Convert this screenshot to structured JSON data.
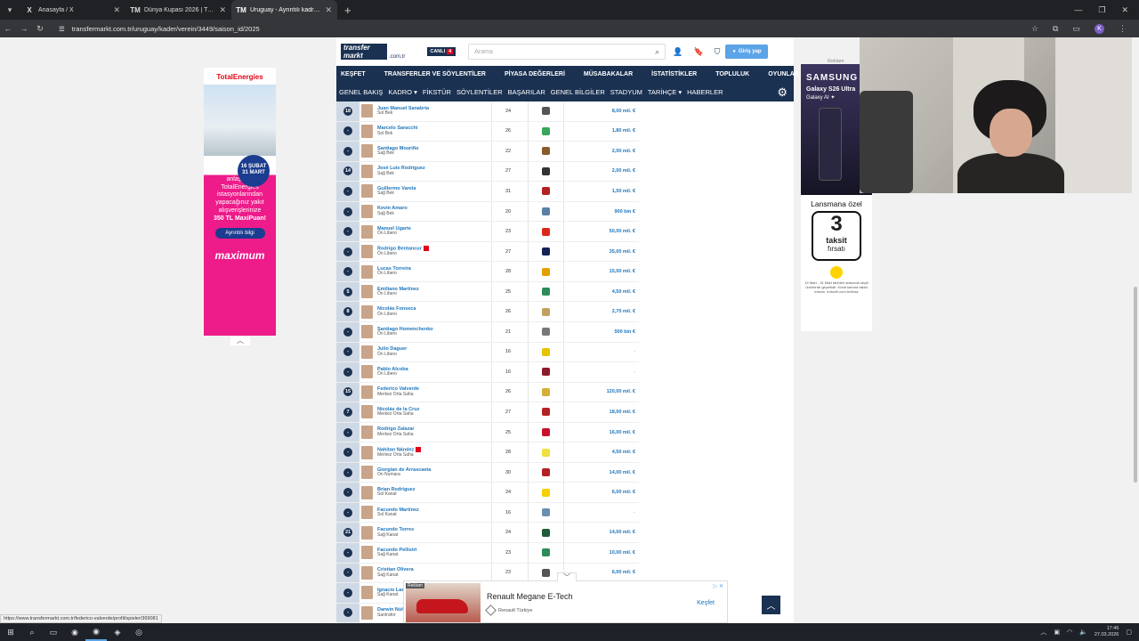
{
  "browser": {
    "tabs": [
      {
        "icon": "X",
        "title": "Anasayfa / X",
        "active": false
      },
      {
        "icon": "TM",
        "title": "Dünya Kupası 2026 | Transferm",
        "active": false
      },
      {
        "icon": "TM",
        "title": "Uruguay - Ayrıntılı kadro 2025",
        "active": true
      }
    ],
    "url": "transfermarkt.com.tr/uruguay/kader/verein/3449/saison_id/2025",
    "profile_letter": "K"
  },
  "site": {
    "logo_line1": "transfer",
    "logo_line2": "markt",
    "domain": ".com.tr",
    "live_label": "CANLI",
    "live_count": "4",
    "search_placeholder": "Arama",
    "login_label": "Giriş yap"
  },
  "nav_main": [
    "KEŞFET",
    "TRANSFERLER VE SÖYLENTİLER",
    "PİYASA DEĞERLERİ",
    "MÜSABAKALAR",
    "İSTATİSTİKLER",
    "TOPLULUK",
    "OYUNLAR"
  ],
  "nav_sub": [
    "GENEL BAKIŞ",
    "KADRO ▾",
    "FİKSTÜR",
    "SÖYLENTİLER",
    "BAŞARILAR",
    "GENEL BİLGİLER",
    "STADYUM",
    "TARİHÇE ▾",
    "HABERLER"
  ],
  "players": [
    {
      "num": "18",
      "name": "Juan Manuel Sanabria",
      "pos": "Sol Bek",
      "age": "24",
      "club_color": "#555555",
      "value": "8,00 mil. €",
      "flag": false
    },
    {
      "num": "-",
      "name": "Marcelo Saracchi",
      "pos": "Sol Bek",
      "age": "26",
      "club_color": "#3aa55c",
      "value": "1,80 mil. €",
      "flag": false
    },
    {
      "num": "-",
      "name": "Santiago Mouriño",
      "pos": "Sağ Bek",
      "age": "22",
      "club_color": "#8b5a2b",
      "value": "2,00 mil. €",
      "flag": false
    },
    {
      "num": "14",
      "name": "José Luis Rodríguez",
      "pos": "Sağ Bek",
      "age": "27",
      "club_color": "#333333",
      "value": "2,00 mil. €",
      "flag": false
    },
    {
      "num": "-",
      "name": "Guillermo Varela",
      "pos": "Sağ Bek",
      "age": "31",
      "club_color": "#b22222",
      "value": "1,50 mil. €",
      "flag": false
    },
    {
      "num": "-",
      "name": "Kevin Amaro",
      "pos": "Sağ Bek",
      "age": "20",
      "club_color": "#5b7fa6",
      "value": "900 bin €",
      "flag": false
    },
    {
      "num": "-",
      "name": "Manuel Ugarte",
      "pos": "Ön Libero",
      "age": "23",
      "club_color": "#da291c",
      "value": "50,00 mil. €",
      "flag": false
    },
    {
      "num": "-",
      "name": "Rodrigo Bentancur",
      "pos": "Ön Libero",
      "age": "27",
      "club_color": "#132257",
      "value": "35,00 mil. €",
      "flag": true
    },
    {
      "num": "-",
      "name": "Lucas Torreira",
      "pos": "Ön Libero",
      "age": "28",
      "club_color": "#e2a000",
      "value": "15,00 mil. €",
      "flag": false
    },
    {
      "num": "5",
      "name": "Emiliano Martínez",
      "pos": "Ön Libero",
      "age": "25",
      "club_color": "#2e8b57",
      "value": "4,50 mil. €",
      "flag": false
    },
    {
      "num": "8",
      "name": "Nicolás Fonseca",
      "pos": "Ön Libero",
      "age": "26",
      "club_color": "#c0a060",
      "value": "2,70 mil. €",
      "flag": false
    },
    {
      "num": "-",
      "name": "Santiago Homenchenko",
      "pos": "Ön Libero",
      "age": "21",
      "club_color": "#777777",
      "value": "500 bin €",
      "flag": false
    },
    {
      "num": "-",
      "name": "Julio Daguer",
      "pos": "Ön Libero",
      "age": "16",
      "club_color": "#e6c200",
      "value": "-",
      "flag": false
    },
    {
      "num": "-",
      "name": "Pablo Alcoba",
      "pos": "Ön Libero",
      "age": "16",
      "club_color": "#8b1a2b",
      "value": "-",
      "flag": false
    },
    {
      "num": "15",
      "name": "Federico Valverde",
      "pos": "Merkez Orta Saha",
      "age": "26",
      "club_color": "#d4af37",
      "value": "120,00 mil. €",
      "flag": false
    },
    {
      "num": "7",
      "name": "Nicolás de la Cruz",
      "pos": "Merkez Orta Saha",
      "age": "27",
      "club_color": "#b22222",
      "value": "18,00 mil. €",
      "flag": false
    },
    {
      "num": "-",
      "name": "Rodrigo Zalazar",
      "pos": "Merkez Orta Saha",
      "age": "25",
      "club_color": "#c8102e",
      "value": "16,00 mil. €",
      "flag": false
    },
    {
      "num": "-",
      "name": "Nahitan Nández",
      "pos": "Merkez Orta Saha",
      "age": "28",
      "club_color": "#f0e040",
      "value": "4,50 mil. €",
      "flag": true
    },
    {
      "num": "-",
      "name": "Giorgian de Arrascaeta",
      "pos": "On Numara",
      "age": "30",
      "club_color": "#b22222",
      "value": "14,00 mil. €",
      "flag": false
    },
    {
      "num": "-",
      "name": "Brian Rodríguez",
      "pos": "Sol Kanat",
      "age": "24",
      "club_color": "#f5d000",
      "value": "6,00 mil. €",
      "flag": false
    },
    {
      "num": "-",
      "name": "Facundo Martínez",
      "pos": "Sol Kanat",
      "age": "16",
      "club_color": "#6a8fb0",
      "value": "-",
      "flag": false
    },
    {
      "num": "21",
      "name": "Facundo Torres",
      "pos": "Sağ Kanat",
      "age": "24",
      "club_color": "#1f5c3a",
      "value": "14,00 mil. €",
      "flag": false
    },
    {
      "num": "-",
      "name": "Facundo Pellistri",
      "pos": "Sağ Kanat",
      "age": "23",
      "club_color": "#2e8b57",
      "value": "10,00 mil. €",
      "flag": false
    },
    {
      "num": "-",
      "name": "Cristian Olivera",
      "pos": "Sağ Kanat",
      "age": "23",
      "club_color": "#555555",
      "value": "6,00 mil. €",
      "flag": false
    },
    {
      "num": "-",
      "name": "Ignacio Laquintana",
      "pos": "Sağ Kanat",
      "age": "26",
      "club_color": "#888888",
      "value": "",
      "flag": false
    },
    {
      "num": "-",
      "name": "Darwin Núñez",
      "pos": "Santrafor",
      "age": "26",
      "club_color": "#888888",
      "value": "",
      "flag": false
    }
  ],
  "left_ad": {
    "brand": "TotalEnergies",
    "date_line1": "16 ŞUBAT",
    "date_line2": "31 MART",
    "text": "Maximum Kart'ında anlaşmalı TotalEnergies istasyonlarından yapacağınız yakıt alışverişlerinize",
    "points": "350 TL MaxiPuan!",
    "button": "Ayrıntılı bilgi",
    "logo": "maximum"
  },
  "right_ad": {
    "label": "Reklam",
    "brand": "SAMSUNG",
    "product": "Galaxy S26 Ultra",
    "sub": "Galaxy AI ✦",
    "launch": "Lansmana özel",
    "number": "3",
    "taksit": "taksit",
    "firsat": "fırsatı",
    "fine": "19 Mart - 31 Mart tarihleri arasında seçili ürünlerde geçerlidir. Kredi kartına taksit imkanı. turkcell.com.tr/cihaz"
  },
  "bottom_ad": {
    "tag": "Reklam",
    "title": "Renault Megane E-Tech",
    "advertiser": "Renault Türkiye",
    "cta": "Keşfet"
  },
  "status_url": "https://www.transfermarkt.com.tr/federico-valverde/profil/spieler/369081",
  "clock": {
    "time": "17:46",
    "date": "27.03.2026"
  }
}
